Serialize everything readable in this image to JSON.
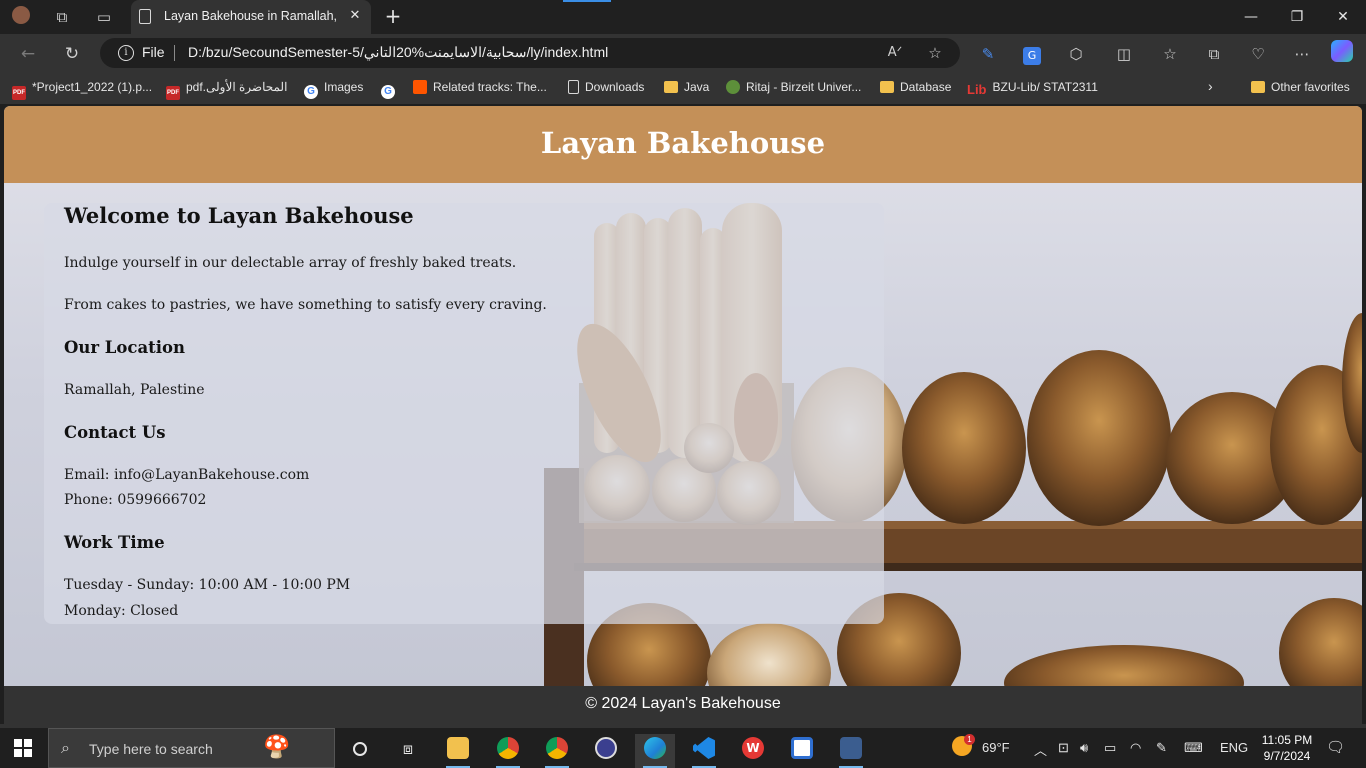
{
  "browser": {
    "tab_title": "Layan Bakehouse in Ramallah, Pal",
    "address_scheme": "File",
    "address_url": "D:/bzu/SecoundSemester-5/سحابية/الاسايمنت%20التاني/ly/index.html"
  },
  "bookmarks": [
    {
      "label": "*Project1_2022 (1).p...",
      "icon": "pdf-icon"
    },
    {
      "label": "pdf.المحاضرة الأولى",
      "icon": "pdf-icon"
    },
    {
      "label": "Images",
      "icon": "google-icon"
    },
    {
      "label": "",
      "icon": "google-icon"
    },
    {
      "label": "Related tracks: The...",
      "icon": "soundcloud-icon"
    },
    {
      "label": "Downloads",
      "icon": "page-icon"
    },
    {
      "label": "Java",
      "icon": "folder-icon"
    },
    {
      "label": "Ritaj - Birzeit Univer...",
      "icon": "ritaj-icon"
    },
    {
      "label": "Database",
      "icon": "folder-icon"
    },
    {
      "label": "BZU-Lib/ STAT2311",
      "icon": "lib-icon"
    }
  ],
  "other_favorites": "Other favorites",
  "page": {
    "site_title": "Layan Bakehouse",
    "welcome_heading": "Welcome to Layan Bakehouse",
    "intro_1": "Indulge yourself in our delectable array of freshly baked treats.",
    "intro_2": "From cakes to pastries, we have something to satisfy every craving.",
    "location_heading": "Our Location",
    "location_text": "Ramallah, Palestine",
    "contact_heading": "Contact Us",
    "contact_email": "Email: info@LayanBakehouse.com",
    "contact_phone": "Phone: 0599666702",
    "work_heading": "Work Time",
    "work_days": "Tuesday - Sunday: 10:00 AM - 10:00 PM",
    "work_closed": "Monday: Closed",
    "footer": "© 2024 Layan's Bakehouse"
  },
  "taskbar": {
    "search_placeholder": "Type here to search",
    "weather": "69°F",
    "language": "ENG",
    "time": "11:05 PM",
    "date": "9/7/2024",
    "weather_badge": "1"
  },
  "colors": {
    "header_bg": "#c49058",
    "footer_bg": "#333333",
    "browser_chrome": "#333333"
  }
}
